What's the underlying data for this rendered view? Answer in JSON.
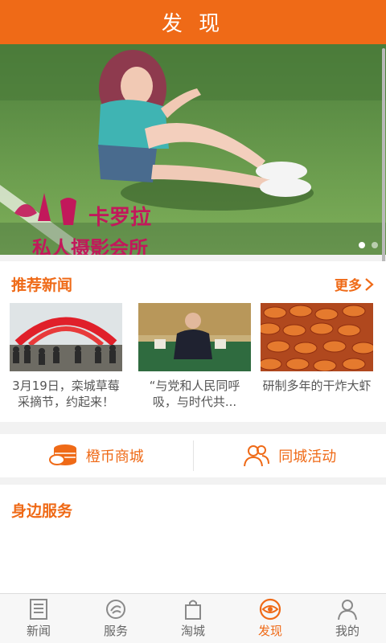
{
  "header": {
    "title": "发 现"
  },
  "banner": {
    "caption_brand": "卡罗拉",
    "caption_sub": "私人摄影会所",
    "slides": 2,
    "active_slide": 1
  },
  "news": {
    "title": "推荐新闻",
    "more_label": "更多",
    "items": [
      {
        "text": "3月19日，栾城草莓采摘节，约起来！"
      },
      {
        "text": "“与党和人民同呼吸，与时代共..."
      },
      {
        "text": "研制多年的干炸大虾"
      }
    ]
  },
  "mall": {
    "left_label": "橙币商城",
    "right_label": "同城活动"
  },
  "service": {
    "title": "身边服务"
  },
  "tabs": [
    {
      "label": "新闻",
      "icon": "newspaper-icon"
    },
    {
      "label": "服务",
      "icon": "service-icon"
    },
    {
      "label": "淘城",
      "icon": "shopping-bag-icon"
    },
    {
      "label": "发现",
      "icon": "eye-icon",
      "active": true
    },
    {
      "label": "我的",
      "icon": "person-icon"
    }
  ],
  "colors": {
    "accent": "#ef6a17",
    "background": "#f2f2f2"
  }
}
